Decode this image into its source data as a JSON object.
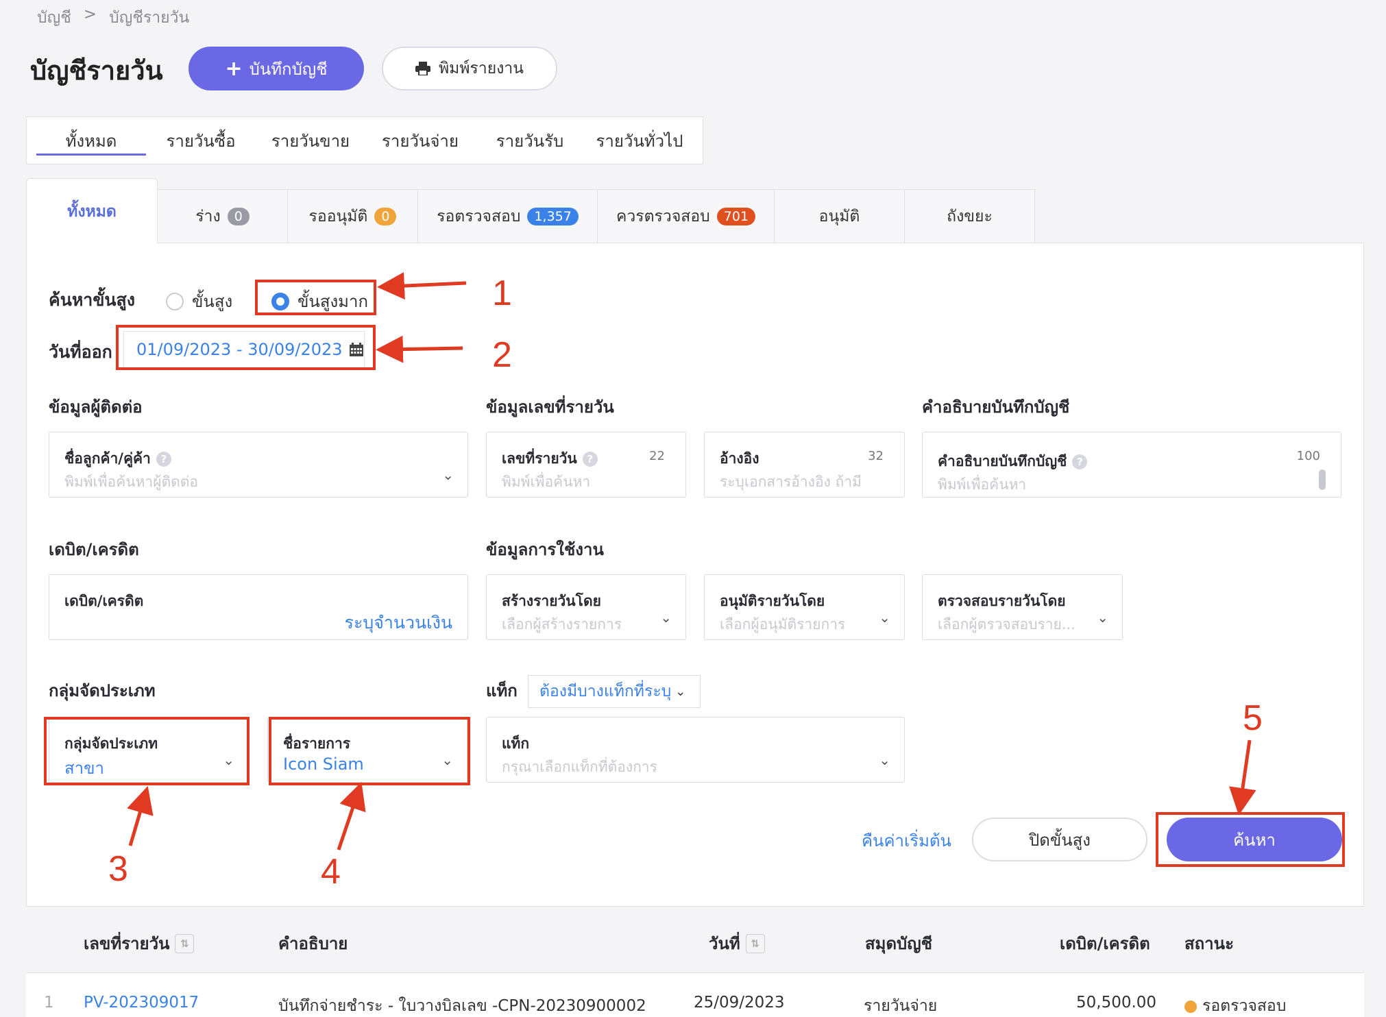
{
  "breadcrumb": {
    "root": "บัญชี",
    "sep": ">",
    "current": "บัญชีรายวัน"
  },
  "header": {
    "title": "บัญชีรายวัน",
    "record_button": "บันทึกบัญชี",
    "print_button": "พิมพ์รายงาน"
  },
  "top_tabs": [
    "ทั้งหมด",
    "รายวันซื้อ",
    "รายวันขาย",
    "รายวันจ่าย",
    "รายวันรับ",
    "รายวันทั่วไป"
  ],
  "status_tabs": [
    {
      "label": "ทั้งหมด",
      "count": ""
    },
    {
      "label": "ร่าง",
      "count": "0"
    },
    {
      "label": "รออนุมัติ",
      "count": "0"
    },
    {
      "label": "รอตรวจสอบ",
      "count": "1,357"
    },
    {
      "label": "ควรตรวจสอบ",
      "count": "701"
    },
    {
      "label": "อนุมัติ",
      "count": ""
    },
    {
      "label": "ถังขยะ",
      "count": ""
    }
  ],
  "search": {
    "advanced_label": "ค้นหาขั้นสูง",
    "option_advanced": "ขั้นสูง",
    "option_very_advanced": "ขั้นสูงมาก",
    "date_label": "วันที่ออก",
    "date_range": "01/09/2023 - 30/09/2023"
  },
  "sections": {
    "contact": "ข้อมูลผู้ติดต่อ",
    "journal_number": "ข้อมูลเลขที่รายวัน",
    "description": "คำอธิบายบันทึกบัญชี",
    "debit_credit": "เดบิต/เครดิต",
    "usage": "ข้อมูลการใช้งาน",
    "category": "กลุ่มจัดประเภท",
    "tag": "แท็ก"
  },
  "fields": {
    "customer": {
      "label": "ชื่อลูกค้า/คู่ค้า",
      "placeholder": "พิมพ์เพื่อค้นหาผู้ติดต่อ"
    },
    "journal_no": {
      "label": "เลขที่รายวัน",
      "placeholder": "พิมพ์เพื่อค้นหา",
      "count": "22"
    },
    "reference": {
      "label": "อ้างอิง",
      "placeholder": "ระบุเอกสารอ้างอิง ถ้ามี",
      "count": "32"
    },
    "desc": {
      "label": "คำอธิบายบันทึกบัญชี",
      "placeholder": "พิมพ์เพื่อค้นหา",
      "count": "100"
    },
    "debit_credit": {
      "label": "เดบิต/เครดิต",
      "link": "ระบุจำนวนเงิน"
    },
    "created_by": {
      "label": "สร้างรายวันโดย",
      "placeholder": "เลือกผู้สร้างรายการ"
    },
    "approved_by": {
      "label": "อนุมัติรายวันโดย",
      "placeholder": "เลือกผู้อนุมัติรายการ"
    },
    "checked_by": {
      "label": "ตรวจสอบรายวันโดย",
      "placeholder": "เลือกผู้ตรวจสอบราย..."
    },
    "category_group": {
      "label": "กลุ่มจัดประเภท",
      "value": "สาขา"
    },
    "item_name": {
      "label": "ชื่อรายการ",
      "value": "Icon Siam"
    },
    "tag_select": "ต้องมีบางแท็กที่ระบุ",
    "tag_field": {
      "label": "แท็ก",
      "placeholder": "กรุณาเลือกแท็กที่ต้องการ"
    }
  },
  "actions": {
    "reset": "คืนค่าเริ่มต้น",
    "close_advanced": "ปิดขั้นสูง",
    "search": "ค้นหา"
  },
  "table": {
    "headers": [
      "เลขที่รายวัน",
      "คำอธิบาย",
      "วันที่",
      "สมุดบัญชี",
      "เดบิต/เครดิต",
      "สถานะ"
    ],
    "rows": [
      {
        "index": "1",
        "number": "PV-202309017",
        "description": "บันทึกจ่ายชำระ - ใบวางบิลเลข -CPN-20230900002",
        "date": "25/09/2023",
        "book": "รายวันจ่าย",
        "amount": "50,500.00",
        "status": "รอตรวจสอบ"
      }
    ]
  },
  "annotations": [
    "1",
    "2",
    "3",
    "4",
    "5"
  ],
  "colors": {
    "primary": "#6b68e6",
    "link": "#3b82e8",
    "annotation": "#e03a22",
    "pending": "#f0a43a"
  }
}
